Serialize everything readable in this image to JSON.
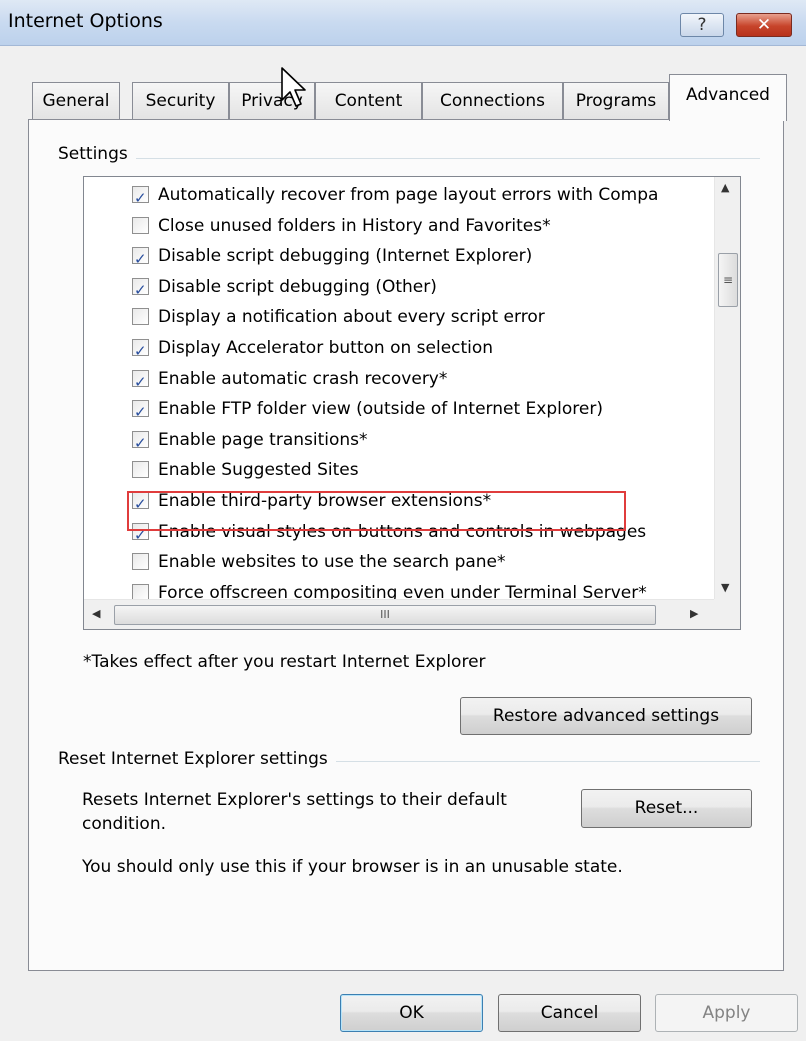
{
  "window": {
    "title": "Internet Options",
    "help_glyph": "?",
    "close_glyph": "✕"
  },
  "tabs": [
    {
      "label": "General"
    },
    {
      "label": "Security"
    },
    {
      "label": "Privacy"
    },
    {
      "label": "Content"
    },
    {
      "label": "Connections"
    },
    {
      "label": "Programs"
    },
    {
      "label": "Advanced",
      "active": true
    }
  ],
  "settings": {
    "group_title": "Settings",
    "items": [
      {
        "label": "Automatically recover from page layout errors with Compa",
        "checked": true
      },
      {
        "label": "Close unused folders in History and Favorites*",
        "checked": false
      },
      {
        "label": "Disable script debugging (Internet Explorer)",
        "checked": true
      },
      {
        "label": "Disable script debugging (Other)",
        "checked": true
      },
      {
        "label": "Display a notification about every script error",
        "checked": false
      },
      {
        "label": "Display Accelerator button on selection",
        "checked": true
      },
      {
        "label": "Enable automatic crash recovery*",
        "checked": true
      },
      {
        "label": "Enable FTP folder view (outside of Internet Explorer)",
        "checked": true
      },
      {
        "label": "Enable page transitions*",
        "checked": true
      },
      {
        "label": "Enable Suggested Sites",
        "checked": false
      },
      {
        "label": "Enable third-party browser extensions*",
        "checked": true,
        "highlighted": true
      },
      {
        "label": "Enable visual styles on buttons and controls in webpages",
        "checked": true
      },
      {
        "label": "Enable websites to use the search pane*",
        "checked": false
      },
      {
        "label": "Force offscreen compositing even under Terminal Server*",
        "checked": false
      }
    ],
    "vscroll_grip": "≡",
    "hscroll_grip": "III",
    "note": "*Takes effect after you restart Internet Explorer",
    "restore_button": "Restore advanced settings"
  },
  "reset": {
    "group_title": "Reset Internet Explorer settings",
    "description_line1": "Resets Internet Explorer's settings to their default",
    "description_line2": "condition.",
    "button": "Reset...",
    "warning": "You should only use this if your browser is in an unusable state."
  },
  "footer": {
    "ok": "OK",
    "cancel": "Cancel",
    "apply": "Apply"
  }
}
